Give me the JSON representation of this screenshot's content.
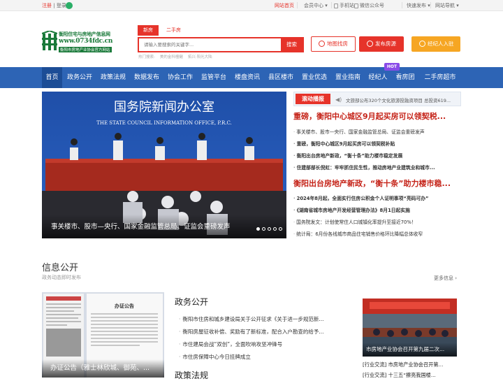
{
  "topbar": {
    "register": "注册",
    "sep": "|",
    "login": "登录",
    "links": [
      "网站首页",
      "会员中心",
      "手机站",
      "微信公众号",
      "快速发布",
      "网站导航"
    ]
  },
  "logo": {
    "line1": "衡阳住宅与房地产信息网",
    "line2": "www.0734fdc.cn",
    "line3": "衡阳市房地产业协会官方网站"
  },
  "search": {
    "tabs": [
      "新房",
      "二手房"
    ],
    "placeholder": "请输入要搜索的关键字...",
    "button": "搜索",
    "hot_label": "热门搜索:",
    "hot_1": "美的金科檀樾",
    "hot_2": "拓兴·阳光大陆"
  },
  "header_buttons": [
    {
      "label": "地图找房",
      "icon": "map-pin-icon"
    },
    {
      "label": "发布房源",
      "icon": "send-icon"
    },
    {
      "label": "经纪人入驻",
      "icon": "agent-icon"
    }
  ],
  "nav": {
    "items": [
      "首页",
      "政务公开",
      "政策法规",
      "数据发布",
      "协会工作",
      "监管平台",
      "楼盘资讯",
      "县区楼市",
      "置业优选",
      "置业指南",
      "经纪人",
      "看房团",
      "二手房超市"
    ],
    "hot_badge": "HOT"
  },
  "slider": {
    "image_sign_cn": "国务院新闻办公室",
    "image_sign_en": "THE STATE COUNCIL INFORMATION OFFICE, P.R.C.",
    "caption": "事关楼市、股市—央行、国家金融监管总局、证监会重磅发声"
  },
  "scroll": {
    "label": "滚动播报",
    "text": "文旅部公布320个文化旅游投融资项目 总投资619..."
  },
  "news": {
    "headline1": "重磅，衡阳中心城区9月起买房可以领契税...",
    "items1": [
      {
        "text": "事关楼市、股市—央行、国家金融监管总局、证监会重磅发声",
        "bold": false
      },
      {
        "text": "重磅，衡阳中心城区9月起买房可以领契税补贴",
        "bold": true
      },
      {
        "text": "衡阳出台房地产新政，“衡十条”助力楼市稳定发展",
        "bold": true
      },
      {
        "text": "住建部部长倪虹：牢牢抓住民生性，推动房地产业建筑业和城市...",
        "bold": true
      }
    ],
    "headline2": "衡阳出台房地产新政，“衡十条”助力楼市稳...",
    "items2": [
      {
        "text": "2024年8月起，全面实行住房公积金个人证明事项“亮码可办”",
        "bold": true
      },
      {
        "text": "《湖南省城市房地产开发经营管理办法》8月1日起实施",
        "bold": true
      },
      {
        "text": "国务院发文：计划使常住人口城镇化率提升至接近70%！",
        "bold": false
      },
      {
        "text": "统计局：6月份各线城市商品住宅销售价格环比降幅总体收窄",
        "bold": false
      }
    ]
  },
  "info": {
    "title": "信息公开",
    "subtitle": "政务动态即时发布",
    "more": "更多信息",
    "doc_caption": "办证公告（雅士林欣城、御苑、...",
    "doc_header": "办证公告",
    "gov_title": "政务公开",
    "gov_items": [
      "衡阳市住房和城乡建设局关于公开征求《关于进一步规范新...",
      "衡阳房屋征收补偿、奖励有了新标准，配合入户勘查的给予...",
      "市住建局会战“双创”，全面吹响攻坚冲锋号",
      "市住房保障中心今日挂牌成立"
    ],
    "policy_title": "政策法规",
    "photo_caption": "市房地产业协会召开第九届二次...",
    "right_items": [
      "[行业交流] 市房地产业协会召开第...",
      "[行业交流] 十三五“擦亮我国楼..."
    ]
  }
}
